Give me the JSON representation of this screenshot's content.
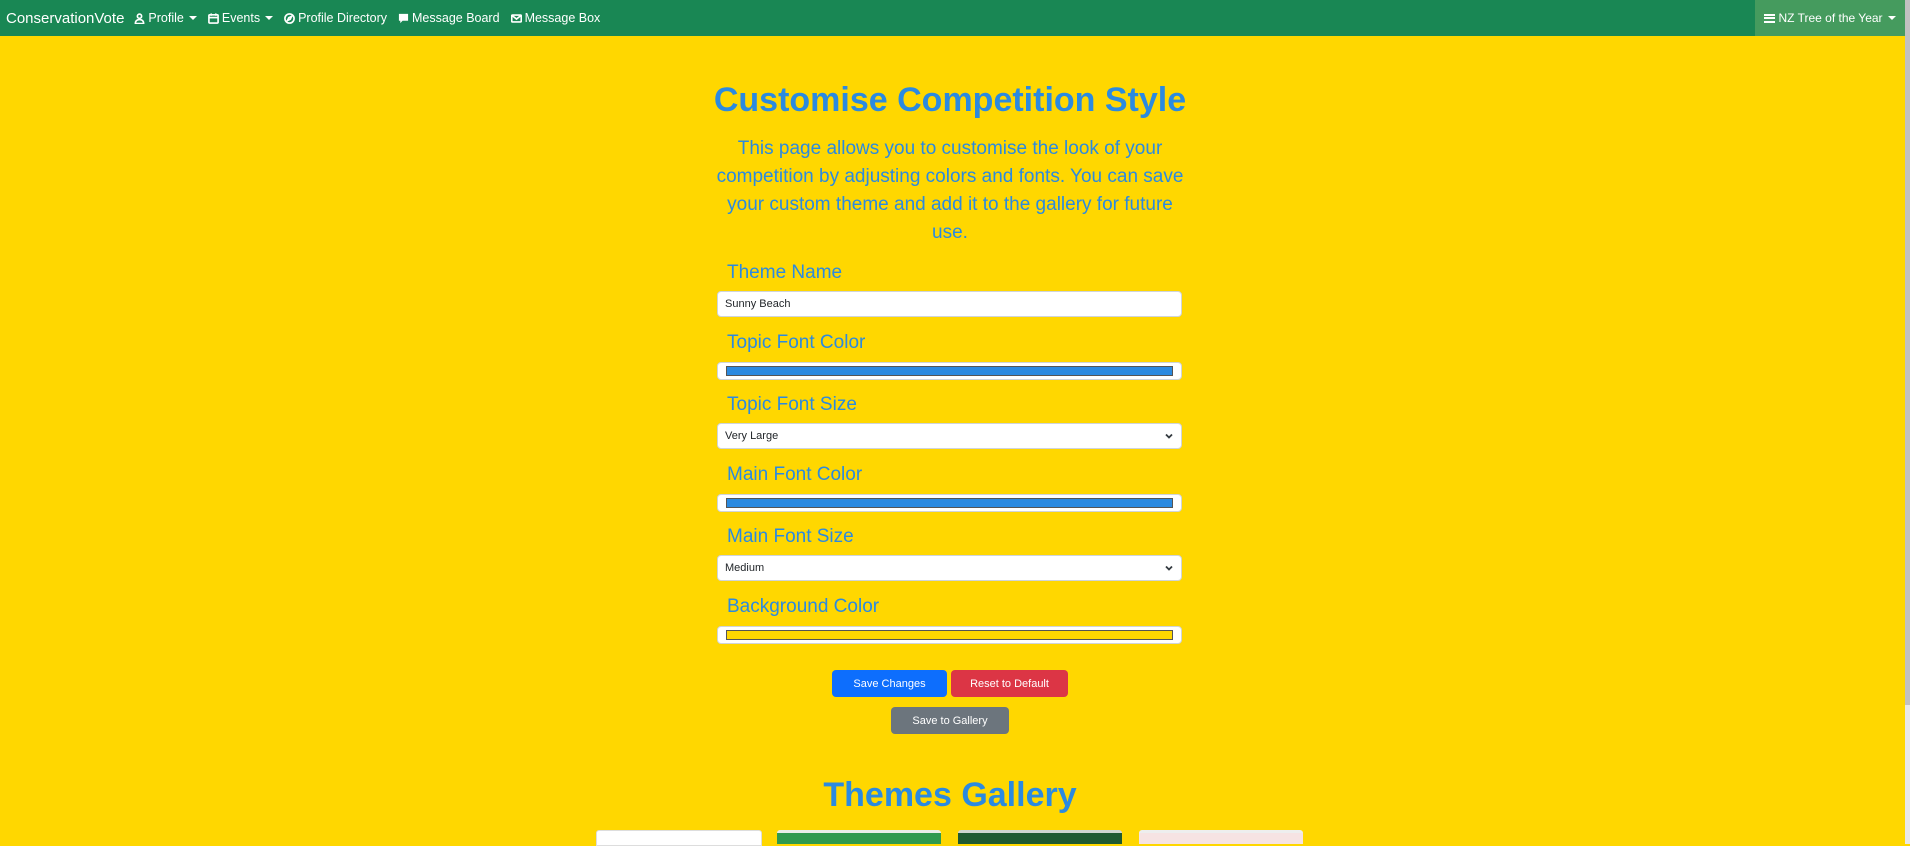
{
  "navbar": {
    "brand": "ConservationVote",
    "items": [
      {
        "label": "Profile",
        "icon": "person-icon",
        "dropdown": true
      },
      {
        "label": "Events",
        "icon": "calendar-icon",
        "dropdown": true
      },
      {
        "label": "Profile Directory",
        "icon": "compass-icon",
        "dropdown": false
      },
      {
        "label": "Message Board",
        "icon": "chat-icon",
        "dropdown": false
      },
      {
        "label": "Message Box",
        "icon": "envelope-icon",
        "dropdown": false
      }
    ],
    "competition": {
      "label": "NZ Tree of the Year",
      "icon": "list-icon"
    }
  },
  "page": {
    "title": "Customise Competition Style",
    "intro": "This page allows you to customise the look of your competition by adjusting colors and fonts. You can save your custom theme and add it to the gallery for future use."
  },
  "form": {
    "theme_name": {
      "label": "Theme Name",
      "value": "Sunny Beach"
    },
    "topic_font_color": {
      "label": "Topic Font Color",
      "value": "#2b8ae0"
    },
    "topic_font_size": {
      "label": "Topic Font Size",
      "value": "Very Large"
    },
    "main_font_color": {
      "label": "Main Font Color",
      "value": "#2b8ae0"
    },
    "main_font_size": {
      "label": "Main Font Size",
      "value": "Medium"
    },
    "background_color": {
      "label": "Background Color",
      "value": "#ffd700"
    }
  },
  "buttons": {
    "save": "Save Changes",
    "reset": "Reset to Default",
    "gallery": "Save to Gallery"
  },
  "gallery": {
    "title": "Themes Gallery",
    "thumbnails": [
      {
        "name": "theme-thumbnail-1",
        "color": "#ffffff"
      },
      {
        "name": "theme-thumbnail-2",
        "color": "#2f9a4f"
      },
      {
        "name": "theme-thumbnail-3",
        "color": "#1f5a32"
      },
      {
        "name": "theme-thumbnail-4",
        "color": "#f6e3e3"
      }
    ]
  },
  "colors": {
    "navbar": "#198754",
    "page_background": "#ffd700",
    "accent_text": "#2b8ae0",
    "primary_button": "#0d6efd",
    "danger_button": "#dc3545",
    "secondary_button": "#6c757d"
  }
}
